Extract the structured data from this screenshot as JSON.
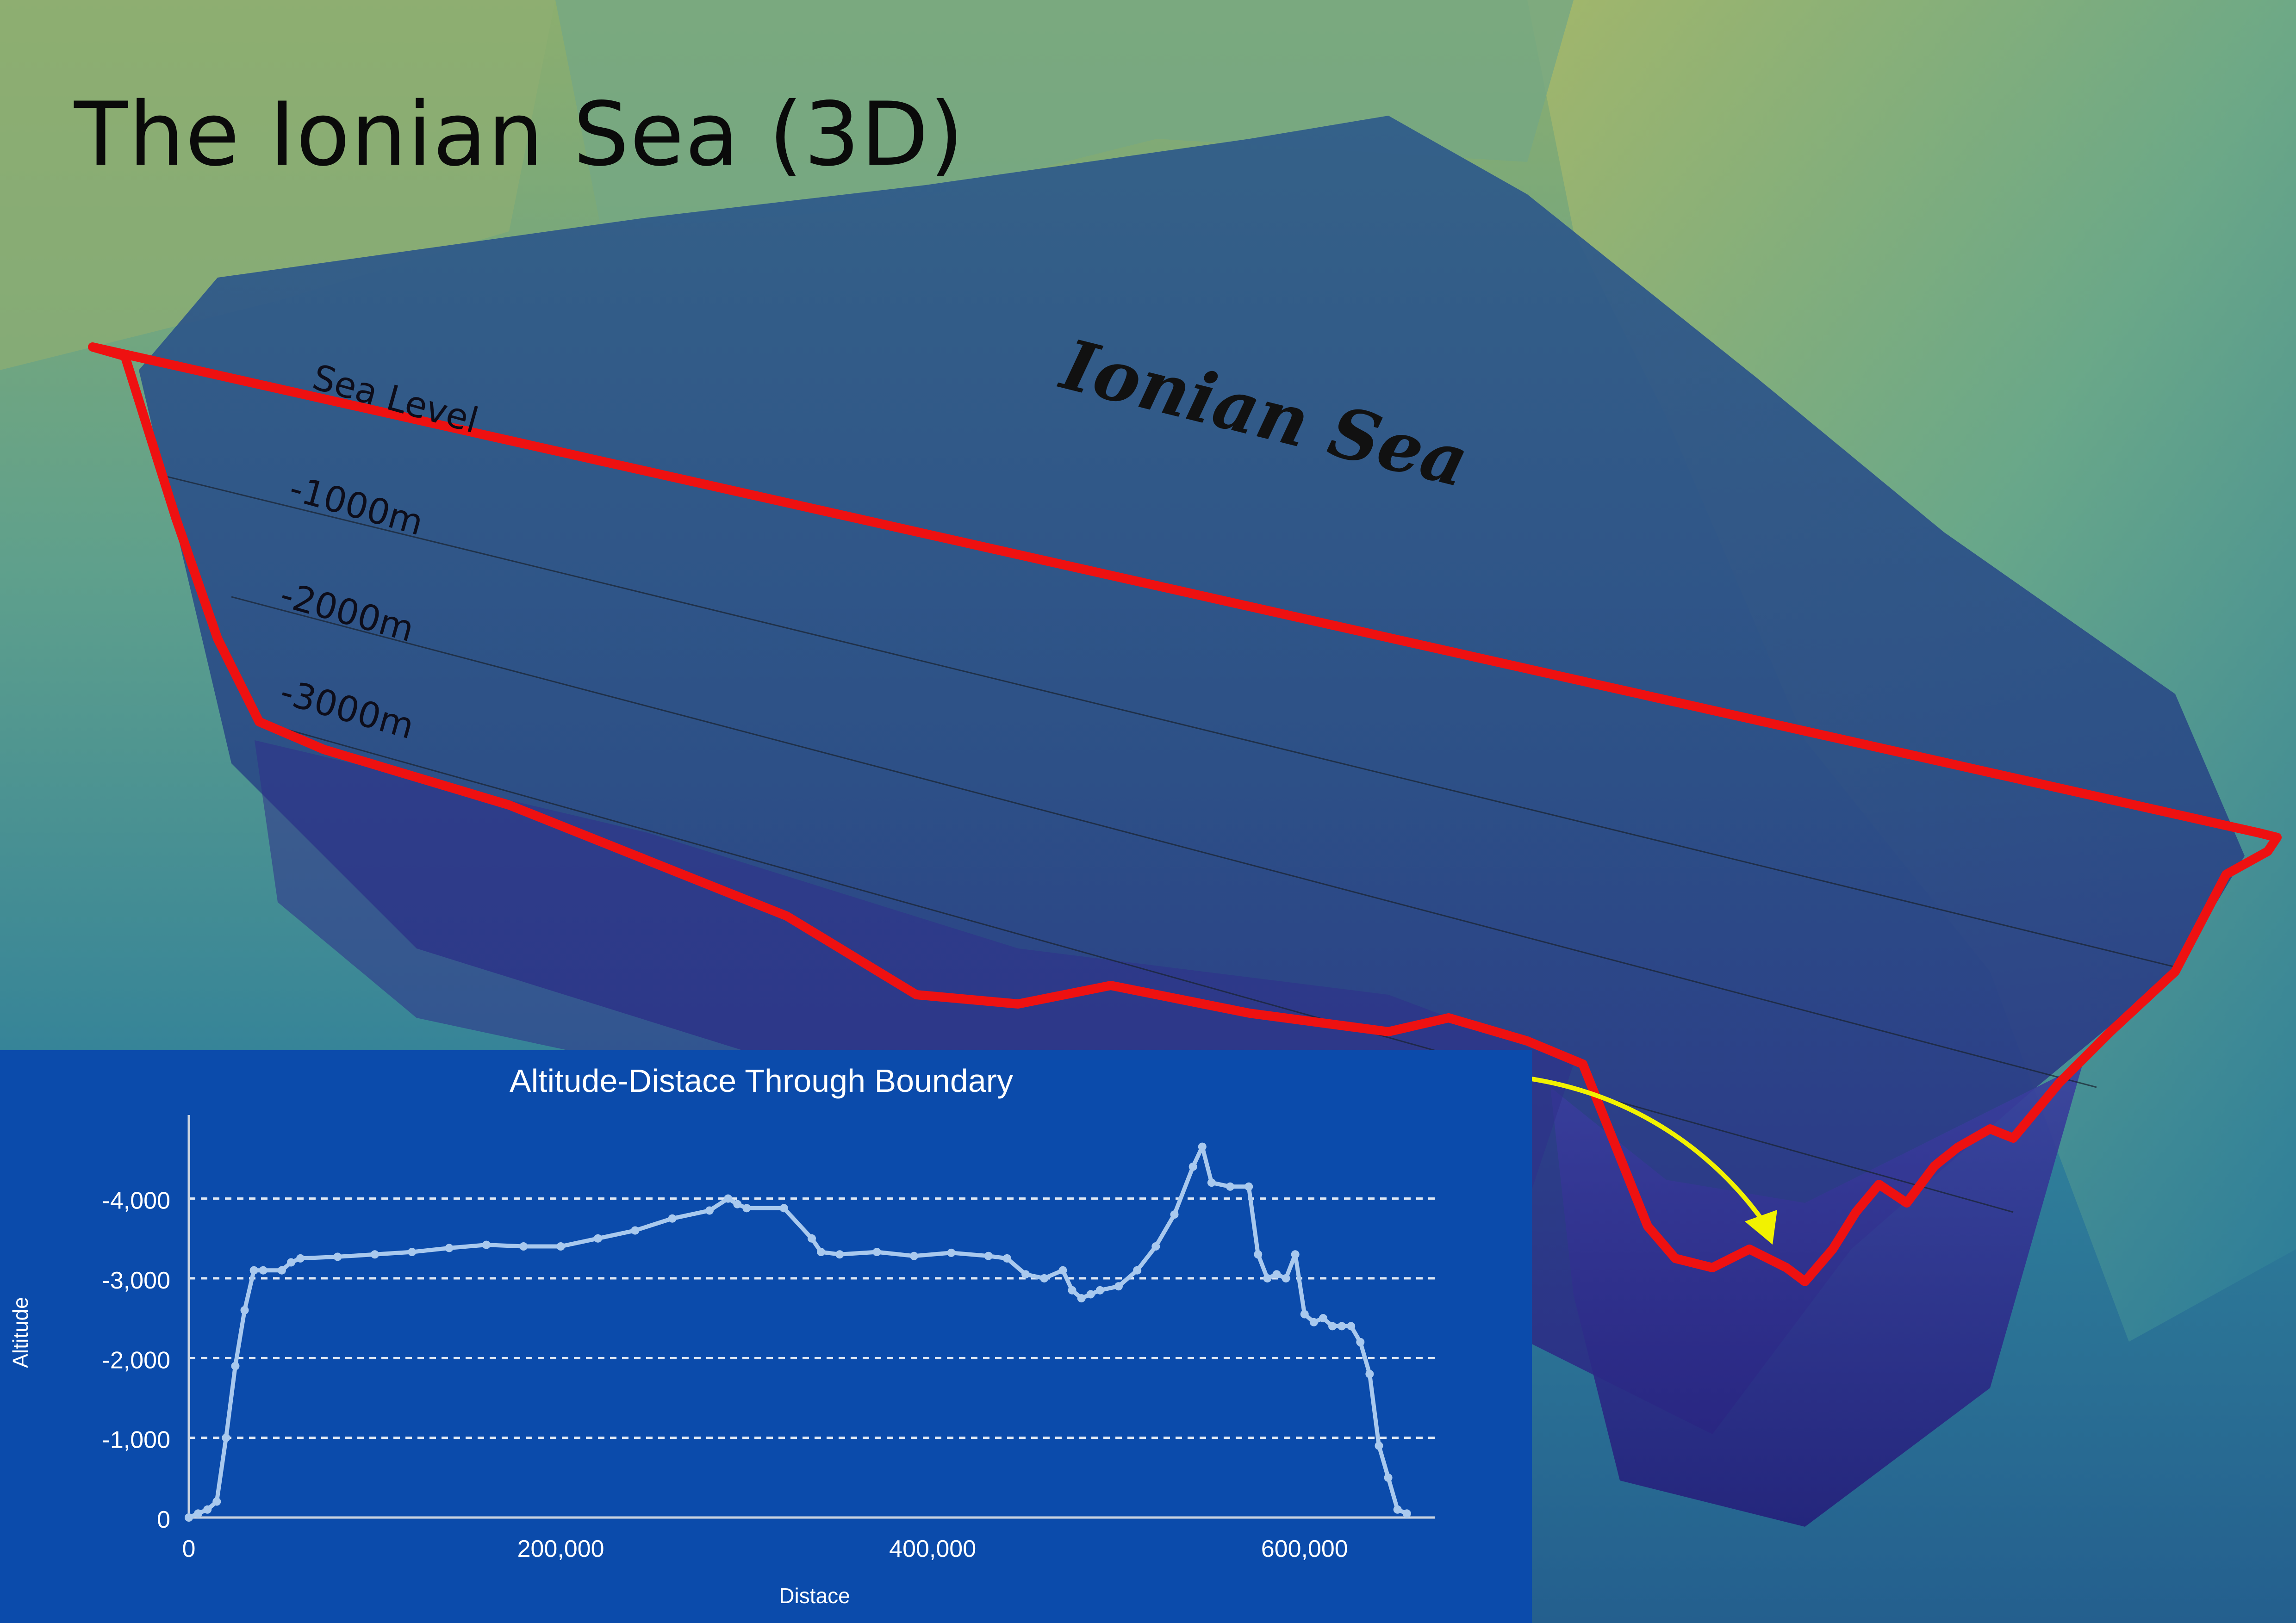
{
  "title": "The Ionian Sea (3D)",
  "map_label": "Ionian Sea",
  "depth_labels": [
    "Sea Level",
    "-1000m",
    "-2000m",
    "-3000m"
  ],
  "colors": {
    "boundary": "#ee1111",
    "arrow": "#f2f200",
    "chart_background": "#0b4bab",
    "chart_line": "#a9c9ee",
    "sea_deep": "#2b2f86",
    "land": "#8ab87a"
  },
  "chart_data": {
    "type": "line",
    "title": "Altitude-Distace Through Boundary",
    "xlabel": "Distace",
    "ylabel": "Altitude",
    "xlim": [
      0,
      670000
    ],
    "ylim": [
      0,
      4700
    ],
    "xticks": [
      0,
      200000,
      400000,
      600000
    ],
    "xtick_labels": [
      "0",
      "200,000",
      "400,000",
      "600,000"
    ],
    "yticks": [
      0,
      1000,
      2000,
      3000,
      4000
    ],
    "ytick_labels": [
      "0",
      "-1,000",
      "-2,000",
      "-3,000",
      "-4,000"
    ],
    "grid": "horizontal dashed",
    "series": [
      {
        "x": [
          0,
          5000,
          10000,
          15000,
          20000,
          25000,
          30000,
          35000,
          40000,
          50000,
          55000,
          60000,
          80000,
          100000,
          120000,
          140000,
          160000,
          180000,
          200000,
          220000,
          240000,
          260000,
          280000,
          290000,
          295000,
          300000,
          320000,
          335000,
          340000,
          350000,
          370000,
          390000,
          410000,
          430000,
          440000,
          450000,
          460000,
          470000,
          475000,
          480000,
          485000,
          490000,
          500000,
          510000,
          520000,
          530000,
          540000,
          545000,
          550000,
          560000,
          570000,
          575000,
          580000,
          585000,
          590000,
          595000,
          600000,
          605000,
          610000,
          615000,
          620000,
          625000,
          630000,
          635000,
          640000,
          645000,
          650000,
          655000
        ],
        "y": [
          0,
          50,
          100,
          200,
          1000,
          1900,
          2600,
          3100,
          3100,
          3100,
          3200,
          3250,
          3270,
          3300,
          3330,
          3380,
          3420,
          3400,
          3400,
          3500,
          3600,
          3750,
          3850,
          4000,
          3930,
          3880,
          3880,
          3500,
          3330,
          3300,
          3330,
          3280,
          3320,
          3280,
          3250,
          3050,
          3000,
          3100,
          2850,
          2750,
          2800,
          2850,
          2900,
          3100,
          3400,
          3800,
          4400,
          4650,
          4200,
          4150,
          4150,
          3300,
          3000,
          3050,
          3000,
          3300,
          2550,
          2450,
          2500,
          2400,
          2400,
          2400,
          2200,
          1800,
          900,
          500,
          100,
          50
        ]
      }
    ]
  }
}
